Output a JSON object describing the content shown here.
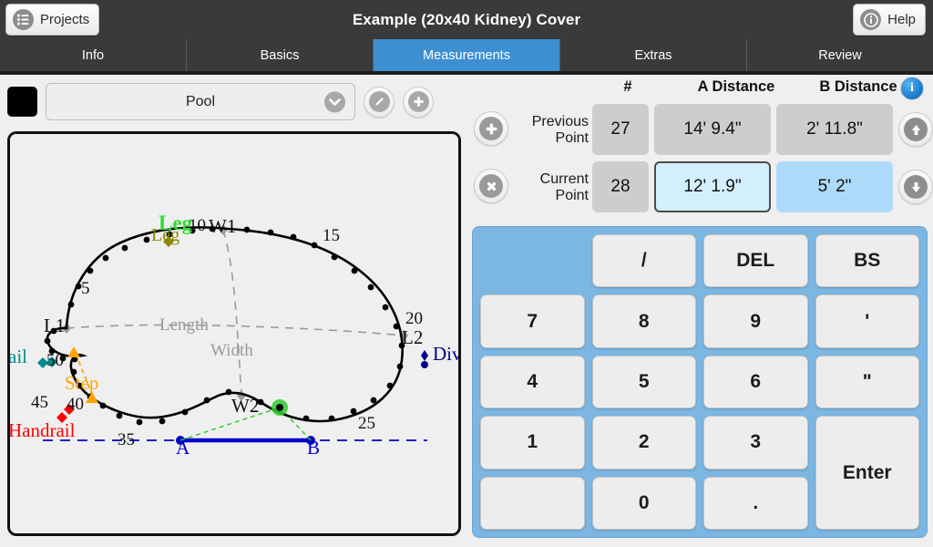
{
  "header": {
    "title": "Example (20x40 Kidney) Cover",
    "projects_label": "Projects",
    "projects_icon": "menu-list-icon",
    "help_label": "Help",
    "help_icon": "info-circle-icon"
  },
  "tabs": [
    {
      "label": "Info",
      "active": false
    },
    {
      "label": "Basics",
      "active": false
    },
    {
      "label": "Measurements",
      "active": true
    },
    {
      "label": "Extras",
      "active": false
    },
    {
      "label": "Review",
      "active": false
    }
  ],
  "toolbar": {
    "swatch_color": "#000000",
    "selected_shape": "Pool",
    "dropdown_icon": "chevron-down-icon",
    "edit_icon": "pencil-icon",
    "add_icon": "plus-icon"
  },
  "measurements": {
    "columns": {
      "number": "#",
      "a": "A Distance",
      "b": "B Distance"
    },
    "info_icon": "info-icon",
    "rows": [
      {
        "role": "previous",
        "label_line1": "Previous",
        "label_line2": "Point",
        "action_icon": "plus-circle-icon",
        "number": "27",
        "a_distance": "14' 9.4\"",
        "b_distance": "2' 11.8\"",
        "side_icon": "arrow-up-icon",
        "selected": false
      },
      {
        "role": "current",
        "label_line1": "Current",
        "label_line2": "Point",
        "action_icon": "x-circle-icon",
        "number": "28",
        "a_distance": "12' 1.9\"",
        "b_distance": "5' 2\"",
        "side_icon": "arrow-down-icon",
        "selected": true
      }
    ]
  },
  "keypad": {
    "accent_color": "#7cb6e3",
    "keys": [
      {
        "label": "",
        "name": "key-blank-top",
        "style": "blank-blue"
      },
      {
        "label": "/",
        "name": "key-slash",
        "style": "key"
      },
      {
        "label": "DEL",
        "name": "key-delete",
        "style": "key"
      },
      {
        "label": "BS",
        "name": "key-backspace",
        "style": "key"
      },
      {
        "label": "7",
        "name": "key-7",
        "style": "key"
      },
      {
        "label": "8",
        "name": "key-8",
        "style": "key"
      },
      {
        "label": "9",
        "name": "key-9",
        "style": "key"
      },
      {
        "label": "'",
        "name": "key-feet",
        "style": "key"
      },
      {
        "label": "4",
        "name": "key-4",
        "style": "key"
      },
      {
        "label": "5",
        "name": "key-5",
        "style": "key"
      },
      {
        "label": "6",
        "name": "key-6",
        "style": "key"
      },
      {
        "label": "\"",
        "name": "key-inches",
        "style": "key"
      },
      {
        "label": "1",
        "name": "key-1",
        "style": "key"
      },
      {
        "label": "2",
        "name": "key-2",
        "style": "key"
      },
      {
        "label": "3",
        "name": "key-3",
        "style": "key"
      },
      {
        "label": "Enter",
        "name": "key-enter",
        "style": "key enter"
      },
      {
        "label": "",
        "name": "key-blank-left",
        "style": "key"
      },
      {
        "label": "0",
        "name": "key-0",
        "style": "key"
      },
      {
        "label": ".",
        "name": "key-decimal",
        "style": "key"
      }
    ]
  },
  "sketch": {
    "title": "Kidney pool outline with measurement points",
    "colors": {
      "outline": "#000000",
      "baseline": "#0000cc",
      "measure_line": "#22cc22",
      "current_point": "#22cc22",
      "step": "#ffa400",
      "handrail": "#ff0000",
      "rail": "#008b8b",
      "leg_green": "#33dd33",
      "leg_olive": "#8a8a00",
      "div": "#00008b",
      "guide": "#9a9a9a"
    },
    "labels": {
      "length": "Length",
      "width": "Width",
      "w1": "W1",
      "w2": "W2",
      "l1": "L1",
      "l2": "L2",
      "a": "A",
      "b": "B",
      "leg_green": "Leg",
      "leg_olive": "Leg",
      "step": "Step",
      "handrail": "Handrail",
      "rail": "Rail",
      "div": "Div"
    },
    "perimeter_numbers": [
      "5",
      "10",
      "15",
      "20",
      "25",
      "35",
      "40",
      "45",
      "50"
    ]
  }
}
